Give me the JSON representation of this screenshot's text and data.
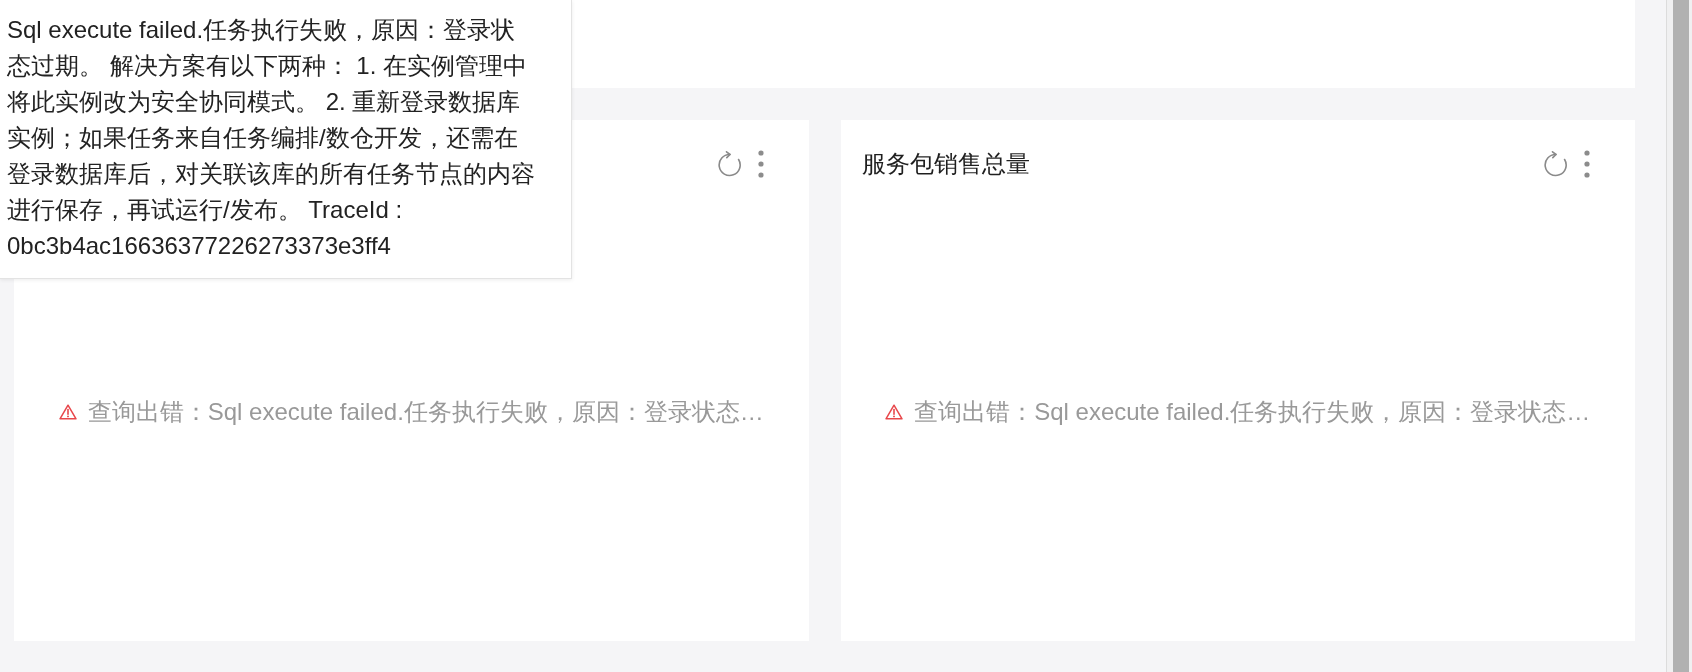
{
  "tooltip": {
    "text": "Sql execute failed.任务执行失败，原因：登录状态过期。 解决方案有以下两种： 1. 在实例管理中将此实例改为安全协同模式。 2. 重新登录数据库实例；如果任务来自任务编排/数仓开发，还需在登录数据库后，对关联该库的所有任务节点的内容进行保存，再试运行/发布。 TraceId : 0bc3b4ac16636377226273373e3ff4"
  },
  "cards": [
    {
      "error": "查询出错：Sql execute failed.任务执行失败，原因：登录状态…"
    },
    {
      "title": "服务包销售总量",
      "error": "查询出错：Sql execute failed.任务执行失败，原因：登录状态…"
    }
  ]
}
